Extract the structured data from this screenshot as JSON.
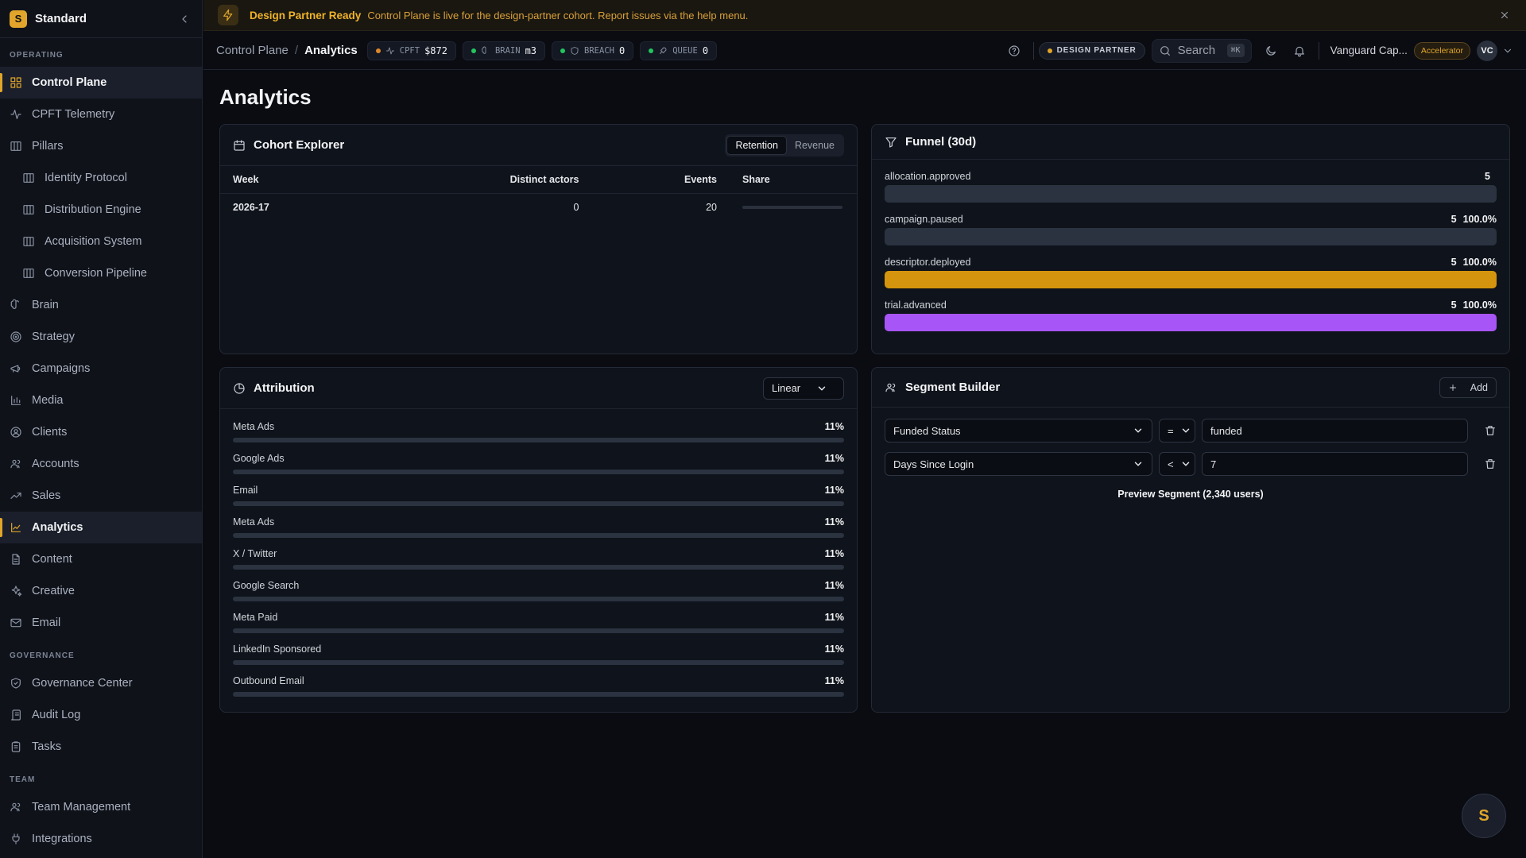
{
  "colors": {
    "accent": "#e0a52a",
    "funnel_gray": "#2b3340",
    "funnel_orange": "#d4940e",
    "funnel_purple": "#a855f7",
    "dot_orange": "#e0872a",
    "dot_green": "#22c55e"
  },
  "sidebar": {
    "brand_initial": "S",
    "brand_name": "Standard",
    "sections": {
      "operating": "OPERATING",
      "governance": "GOVERNANCE",
      "team": "TEAM"
    },
    "items": {
      "control_plane": "Control Plane",
      "cpft_telemetry": "CPFT Telemetry",
      "pillars": "Pillars",
      "identity_protocol": "Identity Protocol",
      "distribution_engine": "Distribution Engine",
      "acquisition_system": "Acquisition System",
      "conversion_pipeline": "Conversion Pipeline",
      "brain": "Brain",
      "strategy": "Strategy",
      "campaigns": "Campaigns",
      "media": "Media",
      "clients": "Clients",
      "accounts": "Accounts",
      "sales": "Sales",
      "analytics": "Analytics",
      "content": "Content",
      "creative": "Creative",
      "email": "Email",
      "governance_center": "Governance Center",
      "audit_log": "Audit Log",
      "tasks": "Tasks",
      "team_management": "Team Management",
      "integrations": "Integrations"
    }
  },
  "banner": {
    "title": "Design Partner Ready",
    "text": "Control Plane is live for the design-partner cohort. Report issues via the help menu."
  },
  "topbar": {
    "crumb_root": "Control Plane",
    "crumb_sep": "/",
    "crumb_current": "Analytics",
    "pills": {
      "cpft_label": "CPFT",
      "cpft_value": "$872",
      "brain_label": "BRAIN",
      "brain_value": "m3",
      "breach_label": "BREACH",
      "breach_value": "0",
      "queue_label": "QUEUE",
      "queue_value": "0"
    },
    "design_partner": "DESIGN PARTNER",
    "search_placeholder": "Search",
    "search_kbd": "⌘K",
    "org_name": "Vanguard Cap...",
    "tier_badge": "Accelerator",
    "avatar_initials": "VC"
  },
  "page": {
    "title": "Analytics"
  },
  "cohort": {
    "title": "Cohort Explorer",
    "tabs": [
      "Retention",
      "Revenue"
    ],
    "active_tab": "Retention",
    "columns": [
      "Week",
      "Distinct actors",
      "Events",
      "Share"
    ],
    "rows": [
      {
        "week": "2026-17",
        "actors": "0",
        "events": "20",
        "share": 0
      }
    ]
  },
  "funnel": {
    "title": "Funnel (30d)",
    "steps": [
      {
        "name": "allocation.approved",
        "count": "5",
        "pct": ""
      },
      {
        "name": "campaign.paused",
        "count": "5",
        "pct": "100.0%"
      },
      {
        "name": "descriptor.deployed",
        "count": "5",
        "pct": "100.0%"
      },
      {
        "name": "trial.advanced",
        "count": "5",
        "pct": "100.0%"
      }
    ]
  },
  "attribution": {
    "title": "Attribution",
    "model": "Linear",
    "rows": [
      {
        "name": "Meta Ads",
        "pct": "11%"
      },
      {
        "name": "Google Ads",
        "pct": "11%"
      },
      {
        "name": "Email",
        "pct": "11%"
      },
      {
        "name": "Meta Ads",
        "pct": "11%"
      },
      {
        "name": "X / Twitter",
        "pct": "11%"
      },
      {
        "name": "Google Search",
        "pct": "11%"
      },
      {
        "name": "Meta Paid",
        "pct": "11%"
      },
      {
        "name": "LinkedIn Sponsored",
        "pct": "11%"
      },
      {
        "name": "Outbound Email",
        "pct": "11%"
      }
    ]
  },
  "segment": {
    "title": "Segment Builder",
    "add_label": "Add",
    "rules": [
      {
        "field": "Funded Status",
        "op": "=",
        "value": "funded"
      },
      {
        "field": "Days Since Login",
        "op": "<",
        "value": "7"
      }
    ],
    "preview_label": "Preview Segment (2,340 users)"
  },
  "fab_initial": "S"
}
